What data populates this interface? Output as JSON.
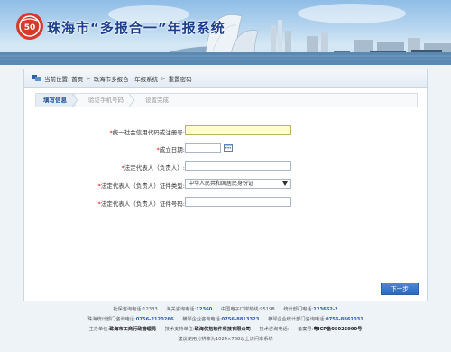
{
  "banner": {
    "title": "珠海市“多报合一”年报系统",
    "logo_text": "50"
  },
  "breadcrumb": {
    "prefix": "当前位置:",
    "items": [
      "首页",
      "珠海市多报合一年报系统",
      "重置密码"
    ],
    "separator": ">"
  },
  "steps": [
    "填写信息",
    "验证手机号码",
    "设置完成"
  ],
  "form": {
    "credit_code": {
      "label": "统一社会信用代码或注册号:",
      "value": ""
    },
    "establish_date": {
      "label": "成立日期:",
      "value": ""
    },
    "legal_rep": {
      "label": "法定代表人（负责人）:",
      "value": ""
    },
    "id_type": {
      "label": "法定代表人（负责人）证件类型:",
      "selected": "中华人民共和国居民身份证"
    },
    "id_number": {
      "label": "法定代表人（负责人）证件号码:",
      "value": ""
    }
  },
  "next_button": "下一步",
  "footer": {
    "line1": {
      "a_label": "社保咨询电话:",
      "a_val": "12333",
      "b_label": "海关咨询电话:",
      "b_val": "12360",
      "c_label": "中国电子口岸热线:",
      "c_val": "95198",
      "d_label": "统计部门电话:",
      "d_val": "123662-2"
    },
    "line2": {
      "a_label": "珠海统计部门咨询电话:",
      "a_val": "0756-2120266",
      "b_label": "横琴企业咨询电话:",
      "b_val": "0756-8813323",
      "c_label": "横琴企业统计部门咨询电话:",
      "c_val": "0756-8861031"
    },
    "line3": {
      "a_label": "主办单位:",
      "a_val": "珠海市工商行政管理局",
      "b_label": "技术支持单位:",
      "b_val": "珠海优拓软件科技有限公司",
      "c_label": "技术咨询电话:",
      "c_val": "",
      "d_label": "备案号:",
      "d_val": "粤ICP备05025990号"
    },
    "line4": "建议使用分辨率为1024×768以上访问本系统"
  },
  "colors": {
    "title": "#1b3f8c",
    "accent_button": "#2c69bf",
    "required": "#dd0000",
    "highlight_input": "#ffffc8"
  }
}
